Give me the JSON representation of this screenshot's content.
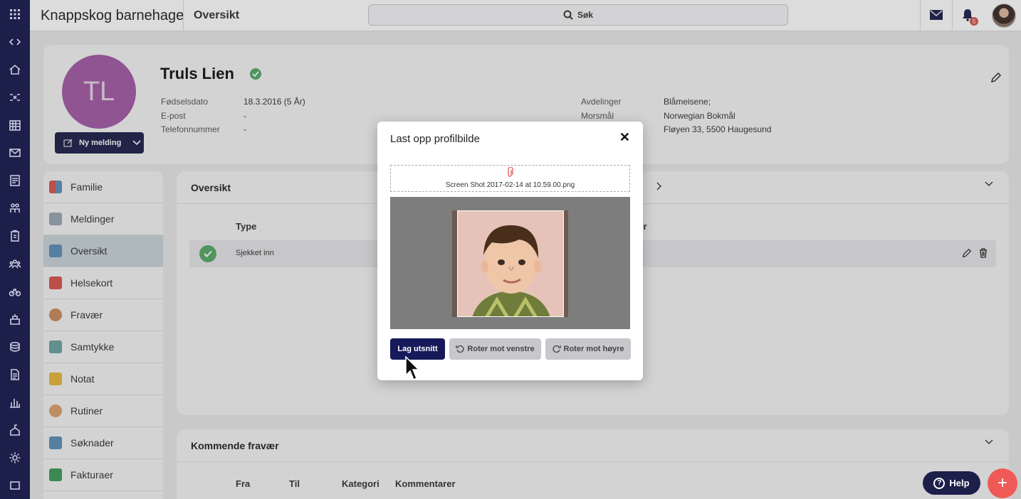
{
  "topbar": {
    "app_title": "Knappskog barnehage",
    "page_title": "Oversikt",
    "search_label": "Søk",
    "notification_count": "5"
  },
  "profile": {
    "initials": "TL",
    "name": "Truls Lien",
    "new_message_label": "Ny melding",
    "left_fields": [
      {
        "label": "Fødselsdato",
        "value": "18.3.2016 (5 År)"
      },
      {
        "label": "E-post",
        "value": "-"
      },
      {
        "label": "Telefonnummer",
        "value": "-"
      }
    ],
    "right_fields": [
      {
        "label": "Avdelinger",
        "value": "Blåmeisene;"
      },
      {
        "label": "Morsmål",
        "value": "Norwegian Bokmål"
      },
      {
        "label": "",
        "value": "Fløyen 33, 5500 Haugesund"
      }
    ]
  },
  "sidebar": {
    "items": [
      {
        "label": "Familie",
        "color": "#d9534f"
      },
      {
        "label": "Meldinger",
        "color": "#9aa5b5"
      },
      {
        "label": "Oversikt",
        "color": "#5b8fb9"
      },
      {
        "label": "Helsekort",
        "color": "#d9534f"
      },
      {
        "label": "Fravær",
        "color": "#c98a5c"
      },
      {
        "label": "Samtykke",
        "color": "#6aa0a0"
      },
      {
        "label": "Notat",
        "color": "#e7b73a"
      },
      {
        "label": "Rutiner",
        "color": "#d9a06b"
      },
      {
        "label": "Søknader",
        "color": "#5b8fb9"
      },
      {
        "label": "Fakturaer",
        "color": "#3c9a5a"
      }
    ],
    "active_index": 2
  },
  "overview": {
    "title": "Oversikt",
    "col_type": "Type",
    "col_comments_partial": "arer",
    "row_status": "Sjekket inn"
  },
  "absence": {
    "title": "Kommende fravær",
    "columns": [
      "Fra",
      "Til",
      "Kategori",
      "Kommentarer"
    ]
  },
  "modal": {
    "title": "Last opp profilbilde",
    "close_label": "✕",
    "file_name": "Screen Shot 2017-02-14 at 10.59.00.png",
    "crop_button": "Lag utsnitt",
    "rotate_left_button": "Roter mot venstre",
    "rotate_right_button": "Roter mot høyre"
  },
  "help": {
    "label": "Help"
  },
  "fab": {
    "label": "+"
  },
  "colors": {
    "brand": "#1c1f4a",
    "accent": "#f05a56",
    "success": "#55a866"
  }
}
